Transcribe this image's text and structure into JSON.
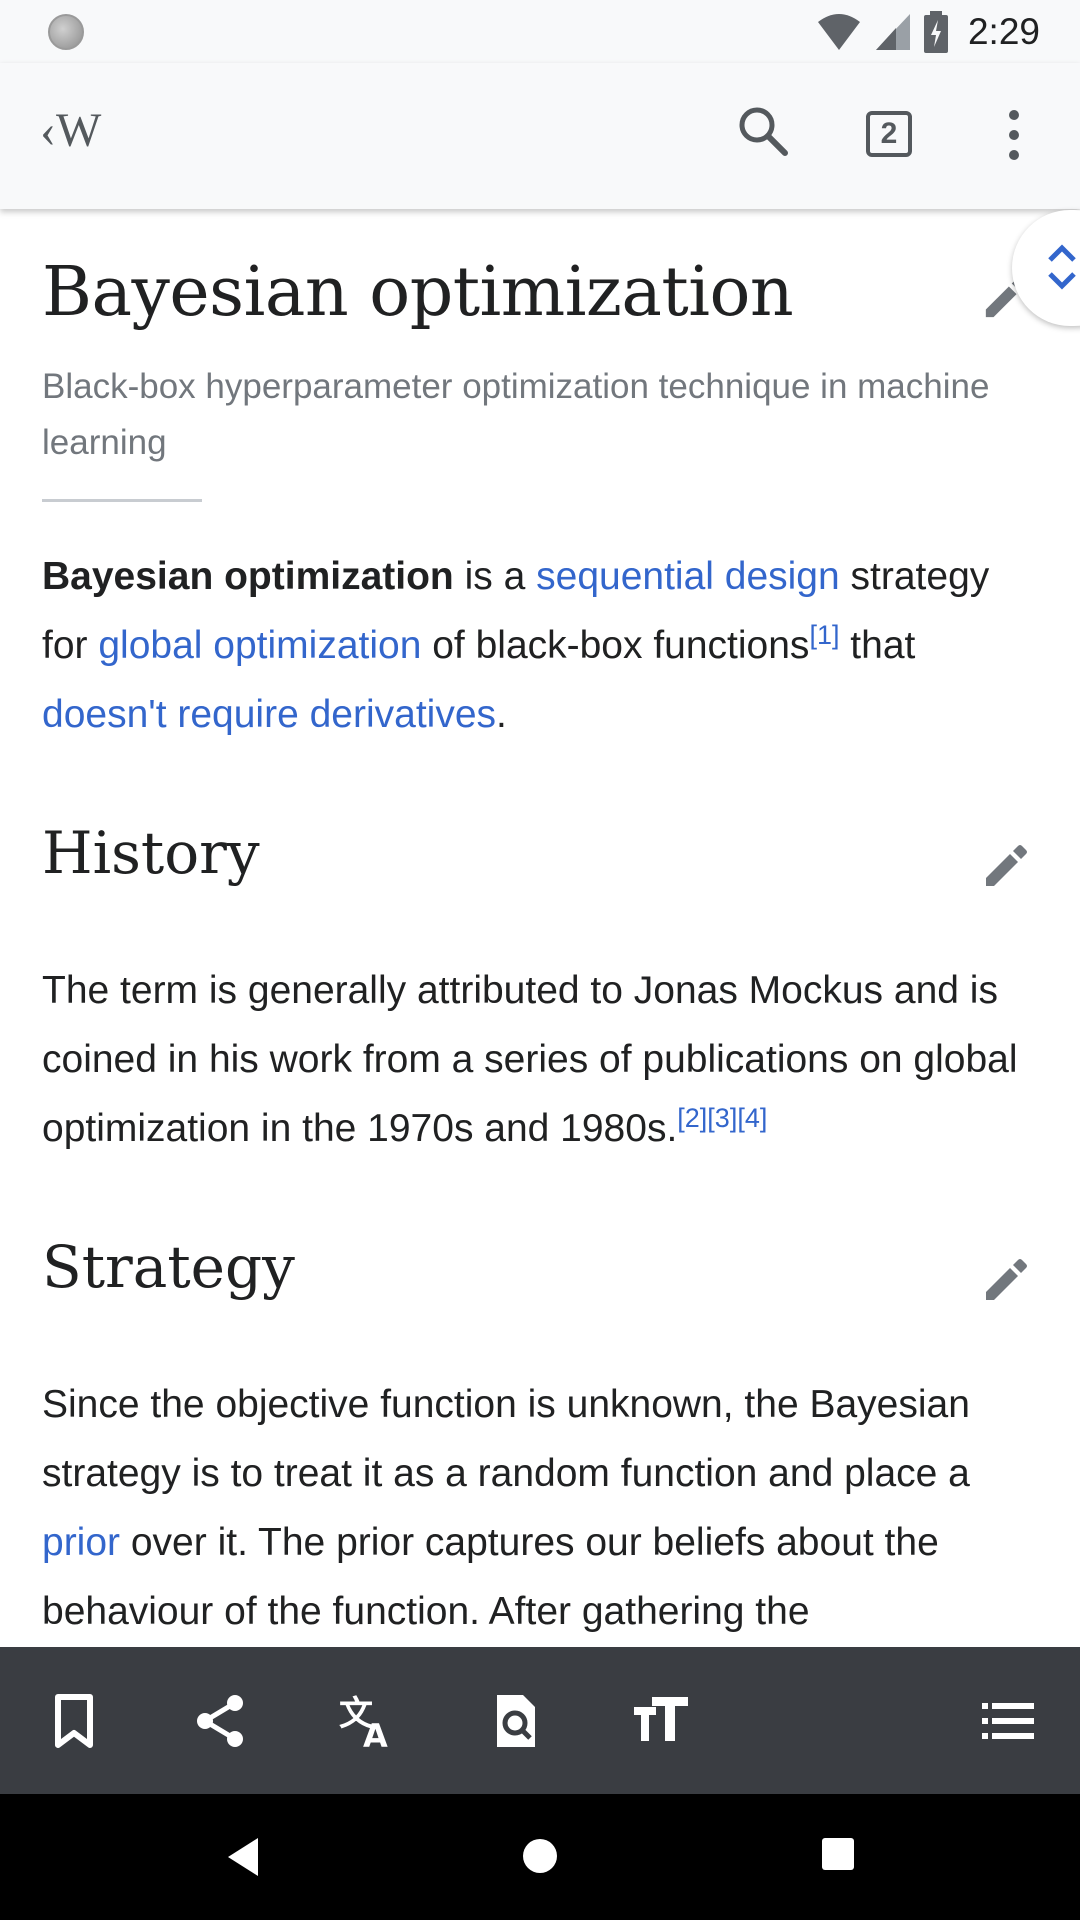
{
  "status_bar": {
    "time": "2:29"
  },
  "toolbar": {
    "logo": "‹W",
    "tab_count": "2"
  },
  "article": {
    "title": "Bayesian optimization",
    "description": "Black-box hyperparameter optimization technique in machine learning",
    "intro": {
      "bold": "Bayesian optimization",
      "t1": " is a ",
      "link1": "sequential design",
      "t2": " strategy for ",
      "link2": "global optimization",
      "t3": " of black-box functions",
      "ref1": "[1]",
      "t4": " that ",
      "link3": "doesn't require derivatives",
      "t5": "."
    },
    "sections": [
      {
        "heading": "History",
        "text": "The term is generally attributed to Jonas Mockus and is coined in his work from a series of publications on global optimization in the 1970s and 1980s.",
        "refs": "[2][3][4]"
      },
      {
        "heading": "Strategy",
        "t1": "Since the objective function is unknown, the Bayesian strategy is to treat it as a random function and place a ",
        "link": "prior",
        "t2": " over it. The prior captures our beliefs about the behaviour of the function. After gathering the"
      }
    ]
  },
  "icons": {
    "status": [
      "loading-icon",
      "wifi-icon",
      "cell-signal-icon",
      "battery-charging-icon"
    ],
    "toolbar": [
      "search-icon",
      "tabs-icon",
      "more-vert-icon"
    ],
    "actions": [
      "bookmark-icon",
      "share-icon",
      "translate-icon",
      "find-in-page-icon",
      "text-size-icon",
      "contents-icon"
    ],
    "nav": [
      "back-icon",
      "home-icon",
      "recents-icon"
    ]
  },
  "colors": {
    "link": "#3366cc",
    "text": "#202122",
    "muted": "#72777d",
    "action_bar": "#3a3d42",
    "toolbar": "#f8f9fa"
  }
}
